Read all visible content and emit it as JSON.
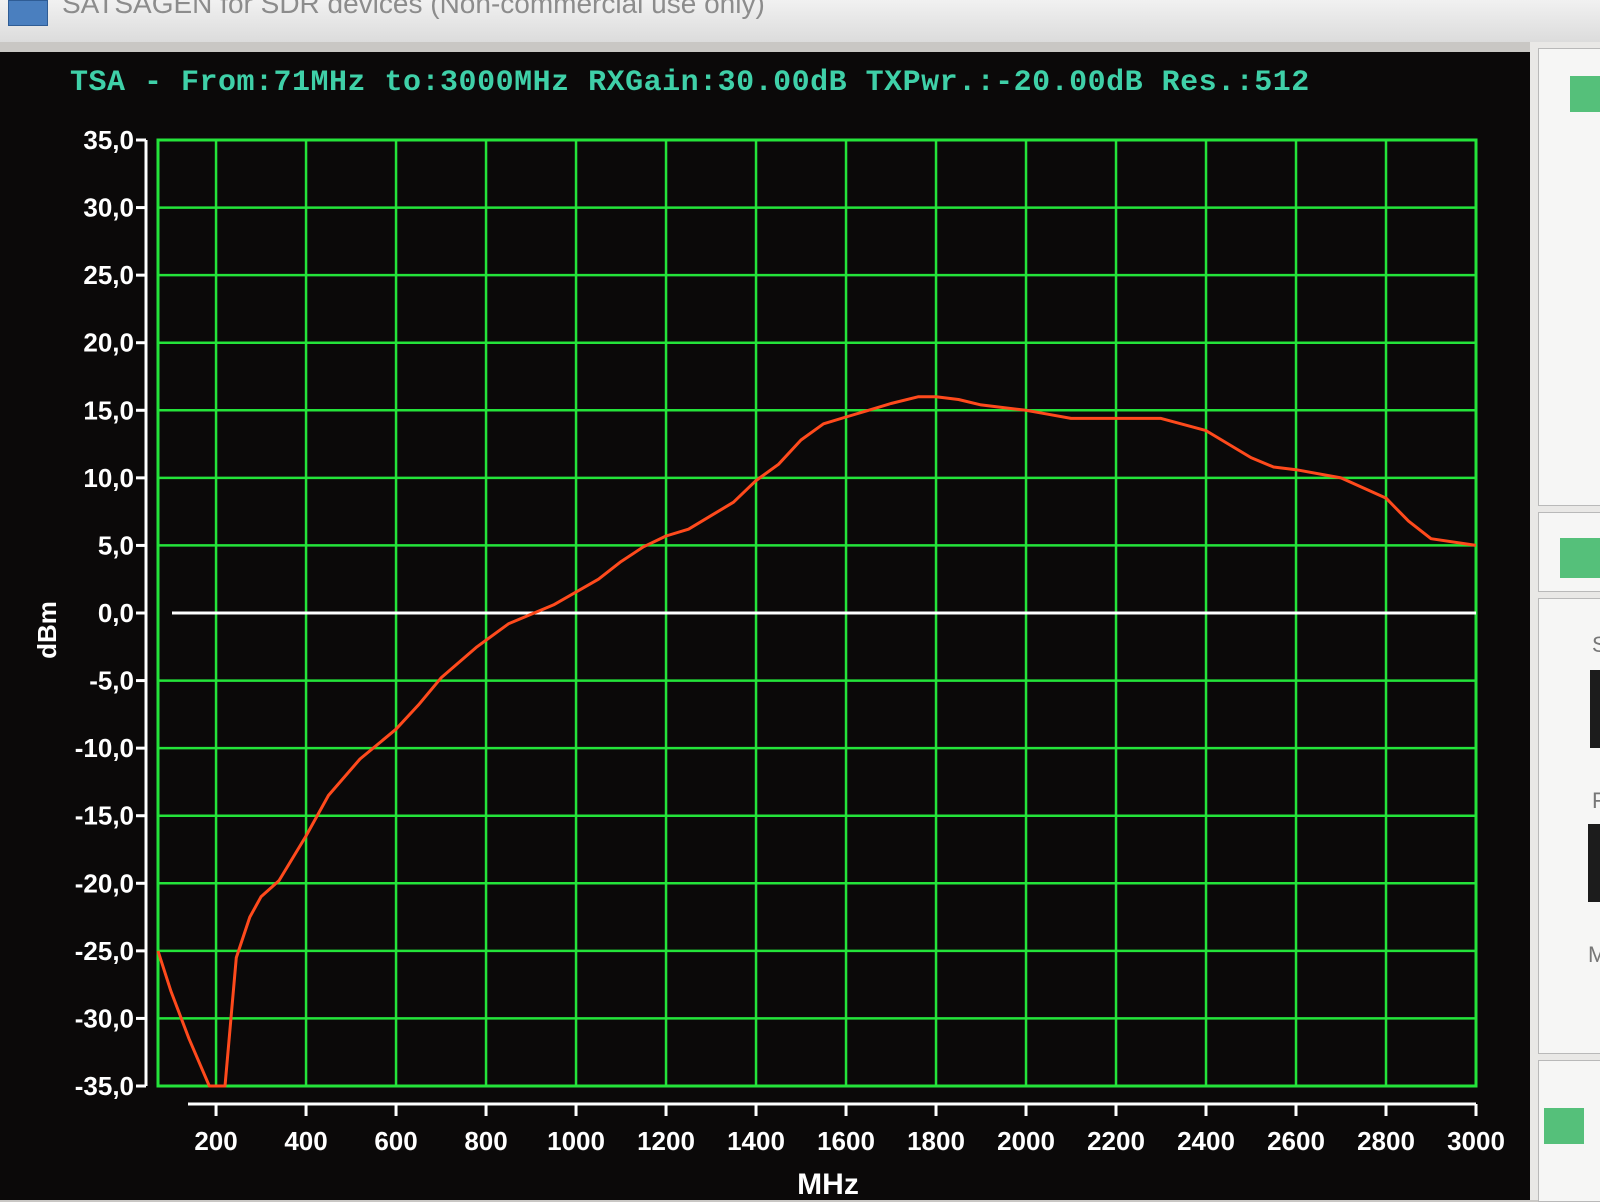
{
  "window": {
    "title": "SATSAGEN for SDR devices (Non-commercial use only)"
  },
  "header": {
    "text": "TSA - From:71MHz to:3000MHz RXGain:30.00dB TXPwr.:-20.00dB Res.:512"
  },
  "side_panel": {
    "letters": [
      "S",
      "F",
      "M"
    ]
  },
  "colors": {
    "grid": "#24e33a",
    "trace": "#ff4a1c",
    "zero_line": "#ffffff",
    "header_text": "#3fd0a8",
    "axis_text": "#ffffff",
    "background": "#0b0909"
  },
  "chart_data": {
    "type": "line",
    "title": "TSA - From:71MHz to:3000MHz RXGain:30.00dB TXPwr.:-20.00dB Res.:512",
    "xlabel": "MHz",
    "ylabel": "dBm",
    "xlim": [
      71,
      3000
    ],
    "ylim": [
      -35,
      35
    ],
    "grid": true,
    "x_ticks": [
      200,
      400,
      600,
      800,
      1000,
      1200,
      1400,
      1600,
      1800,
      2000,
      2200,
      2400,
      2600,
      2800,
      3000
    ],
    "x_tick_labels": [
      "200",
      "400",
      "600",
      "800",
      "1000",
      "1200",
      "1400",
      "1600",
      "1800",
      "2000",
      "2200",
      "2400",
      "2600",
      "2800",
      "3000"
    ],
    "y_ticks": [
      35,
      30,
      25,
      20,
      15,
      10,
      5,
      0,
      -5,
      -10,
      -15,
      -20,
      -25,
      -30,
      -35
    ],
    "y_tick_labels": [
      "35,0",
      "30,0",
      "25,0",
      "20,0",
      "15,0",
      "10,0",
      "5,0",
      "0,0",
      "-5,0",
      "-10,0",
      "-15,0",
      "-20,0",
      "-25,0",
      "-30,0",
      "-35,0"
    ],
    "reference_line_y": 0,
    "series": [
      {
        "x": [
          71,
          100,
          140,
          185,
          200,
          220,
          245,
          275,
          300,
          340,
          400,
          450,
          520,
          600,
          650,
          700,
          780,
          850,
          950,
          1050,
          1100,
          1150,
          1200,
          1250,
          1300,
          1350,
          1400,
          1450,
          1500,
          1550,
          1600,
          1650,
          1700,
          1760,
          1800,
          1850,
          1900,
          1950,
          2000,
          2050,
          2100,
          2200,
          2300,
          2400,
          2450,
          2500,
          2550,
          2600,
          2700,
          2800,
          2850,
          2900,
          3000
        ],
        "y": [
          -25,
          -28,
          -31.5,
          -35,
          -35,
          -35,
          -25.5,
          -22.5,
          -21,
          -19.8,
          -16.5,
          -13.5,
          -10.8,
          -8.6,
          -6.8,
          -4.8,
          -2.5,
          -0.8,
          0.6,
          2.5,
          3.8,
          4.9,
          5.7,
          6.2,
          7.2,
          8.2,
          9.8,
          11.0,
          12.8,
          14.0,
          14.5,
          15.0,
          15.5,
          16.0,
          16.0,
          15.8,
          15.4,
          15.2,
          15.0,
          14.7,
          14.4,
          14.4,
          14.4,
          13.5,
          12.5,
          11.5,
          10.8,
          10.6,
          10.0,
          8.5,
          6.8,
          5.5,
          5.0
        ]
      }
    ]
  }
}
